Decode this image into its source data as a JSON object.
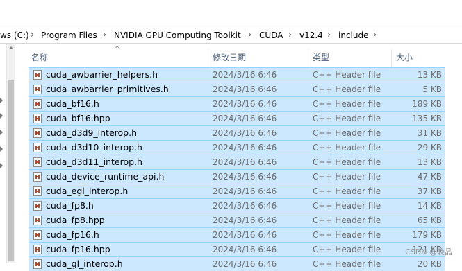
{
  "address": {
    "crumbs": [
      "ws (C:)",
      "Program Files",
      "NVIDIA GPU Computing Toolkit",
      "CUDA",
      "v12.4",
      "include"
    ]
  },
  "columns": {
    "name": "名称",
    "date": "修改日期",
    "type": "类型",
    "size": "大小",
    "sort_indicator": "^"
  },
  "files": [
    {
      "name": "cuda_awbarrier_helpers.h",
      "date": "2024/3/16 6:46",
      "type": "C++ Header file",
      "size": "13 KB"
    },
    {
      "name": "cuda_awbarrier_primitives.h",
      "date": "2024/3/16 6:46",
      "type": "C++ Header file",
      "size": "5 KB"
    },
    {
      "name": "cuda_bf16.h",
      "date": "2024/3/16 6:46",
      "type": "C++ Header file",
      "size": "189 KB"
    },
    {
      "name": "cuda_bf16.hpp",
      "date": "2024/3/16 6:46",
      "type": "C++ Header file",
      "size": "135 KB"
    },
    {
      "name": "cuda_d3d9_interop.h",
      "date": "2024/3/16 6:46",
      "type": "C++ Header file",
      "size": "31 KB"
    },
    {
      "name": "cuda_d3d10_interop.h",
      "date": "2024/3/16 6:46",
      "type": "C++ Header file",
      "size": "29 KB"
    },
    {
      "name": "cuda_d3d11_interop.h",
      "date": "2024/3/16 6:46",
      "type": "C++ Header file",
      "size": "13 KB"
    },
    {
      "name": "cuda_device_runtime_api.h",
      "date": "2024/3/16 6:46",
      "type": "C++ Header file",
      "size": "47 KB"
    },
    {
      "name": "cuda_egl_interop.h",
      "date": "2024/3/16 6:46",
      "type": "C++ Header file",
      "size": "37 KB"
    },
    {
      "name": "cuda_fp8.h",
      "date": "2024/3/16 6:46",
      "type": "C++ Header file",
      "size": "14 KB"
    },
    {
      "name": "cuda_fp8.hpp",
      "date": "2024/3/16 6:46",
      "type": "C++ Header file",
      "size": "65 KB"
    },
    {
      "name": "cuda_fp16.h",
      "date": "2024/3/16 6:46",
      "type": "C++ Header file",
      "size": "179 KB"
    },
    {
      "name": "cuda_fp16.hpp",
      "date": "2024/3/16 6:46",
      "type": "C++ Header file",
      "size": "121 KB"
    },
    {
      "name": "cuda_gl_interop.h",
      "date": "2024/3/16 6:46",
      "type": "C++ Header file",
      "size": "20 KB"
    }
  ],
  "watermark": "CSDN @晚晶",
  "colors": {
    "selection_bg": "#cce8ff",
    "selection_border": "#99d1ff",
    "header_text": "#4c607a",
    "secondary_text": "#6d6d6d"
  }
}
